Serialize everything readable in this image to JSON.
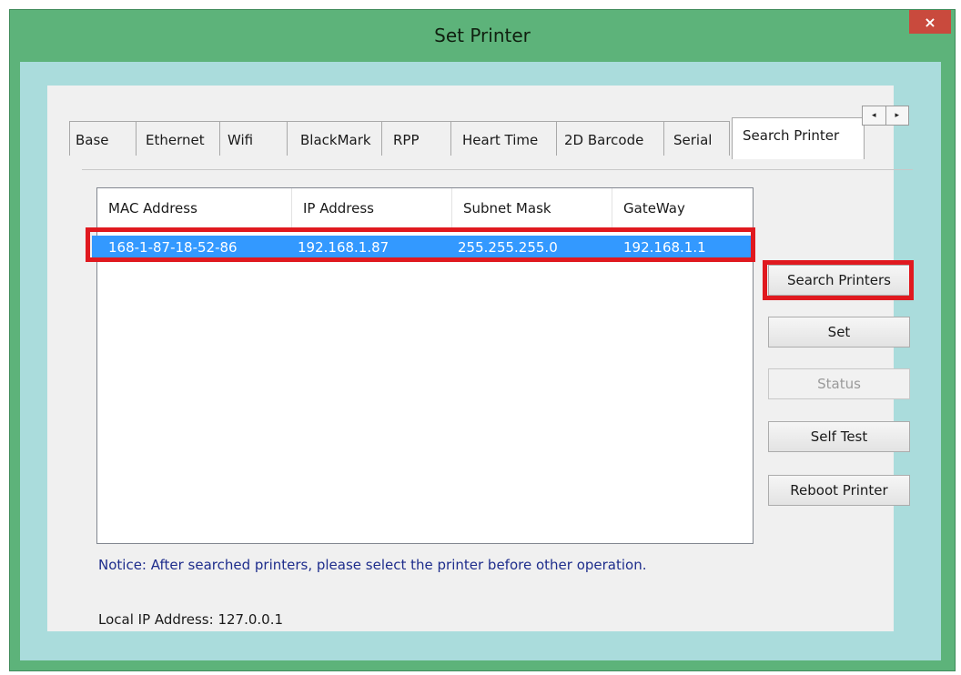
{
  "window": {
    "title": "Set Printer",
    "close_glyph": "×"
  },
  "tabs": [
    {
      "label": "Base",
      "active": false
    },
    {
      "label": "Ethernet",
      "active": false
    },
    {
      "label": "Wifi",
      "active": false
    },
    {
      "label": "BlackMark",
      "active": false
    },
    {
      "label": "RPP",
      "active": false
    },
    {
      "label": "Heart Time",
      "active": false
    },
    {
      "label": "2D Barcode",
      "active": false
    },
    {
      "label": "Serial",
      "active": false
    },
    {
      "label": "Search Printer",
      "active": true
    }
  ],
  "tab_scroll": {
    "left_glyph": "◂",
    "right_glyph": "▸"
  },
  "list": {
    "columns": [
      "MAC Address",
      "IP Address",
      "Subnet Mask",
      "GateWay"
    ],
    "rows": [
      {
        "mac": "168-1-87-18-52-86",
        "ip": "192.168.1.87",
        "subnet": "255.255.255.0",
        "gateway": "192.168.1.1",
        "selected": true
      }
    ]
  },
  "buttons": {
    "search": "Search Printers",
    "set": "Set",
    "status": "Status",
    "self_test": "Self Test",
    "reboot": "Reboot Printer"
  },
  "notice": "Notice: After searched printers, please select the printer before other operation.",
  "local_ip": "Local IP Address: 127.0.0.1",
  "colors": {
    "titlebar": "#5db37a",
    "client": "#aadcdc",
    "selection": "#3399ff",
    "highlight": "#e0191f",
    "close": "#c94a3d"
  }
}
